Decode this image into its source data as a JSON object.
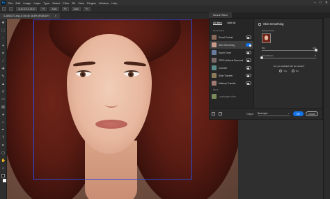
{
  "menubar": {
    "logo": "Ps",
    "items": [
      "File",
      "Edit",
      "Image",
      "Layer",
      "Type",
      "Select",
      "Filter",
      "3D",
      "View",
      "Plugins",
      "Window",
      "Help"
    ],
    "window_controls": [
      "–",
      "□",
      "✕"
    ]
  },
  "optbar": {
    "mode": "1110.0110.0110",
    "items": [
      "Px",
      "Auto",
      "Px",
      "Auto",
      "Px"
    ]
  },
  "doctab": {
    "title": "4-1654372-shp-8.7x6 @ 35.8% (RGB/16*)",
    "close": "×"
  },
  "toolbar": {
    "tools": [
      "move-icon",
      "marquee-icon",
      "lasso-icon",
      "wand-icon",
      "crop-icon",
      "eyedropper-icon",
      "heal-icon",
      "brush-icon",
      "stamp-icon",
      "history-brush-icon",
      "eraser-icon",
      "gradient-icon",
      "blur-icon",
      "dodge-icon",
      "pen-icon",
      "type-icon",
      "path-select-icon",
      "shape-icon",
      "hand-icon",
      "zoom-icon"
    ]
  },
  "neural_filters": {
    "tab_label": "Neural Filters",
    "list_tabs": [
      "All filters",
      "Wait list"
    ],
    "section_featured": "FEATURED",
    "section_beta": "BETA",
    "filters": [
      {
        "label": "Smart Portrait",
        "on": false,
        "selected": false,
        "thumb_color": "#8a6a5a"
      },
      {
        "label": "Skin Smoothing",
        "on": true,
        "selected": true,
        "thumb_color": "#c89a88"
      },
      {
        "label": "Super Zoom",
        "on": false,
        "selected": false,
        "thumb_color": "#6a7a9a"
      },
      {
        "label": "JPEG Artifacts Removal",
        "on": false,
        "selected": false,
        "thumb_color": "#7a6a6a"
      },
      {
        "label": "Colorize",
        "on": false,
        "selected": false,
        "thumb_color": "#5a8a8a"
      },
      {
        "label": "Style Transfer",
        "on": false,
        "selected": false,
        "thumb_color": "#8a7a5a"
      },
      {
        "label": "Makeup Transfer",
        "on": false,
        "selected": false,
        "thumb_color": "#a07a70"
      }
    ],
    "beta_item": {
      "label": "Landscape Mixer",
      "thumb_color": "#7a8a5a"
    },
    "detail": {
      "title": "Skin Smoothing",
      "selected_face_label": "Selected face",
      "blur_label": "Blur",
      "blur_value": 100,
      "smoothness_label": "Smoothness",
      "smoothness_value": 0,
      "question": "Are you satisfied with the results?",
      "yes_label": "Yes",
      "no_label": "No"
    },
    "footer": {
      "output_label": "Output",
      "output_value": "New layer",
      "ok_label": "OK",
      "cancel_label": "Cancel"
    }
  },
  "colors": {
    "accent": "#1473e6",
    "selection": "#2c49d8"
  }
}
